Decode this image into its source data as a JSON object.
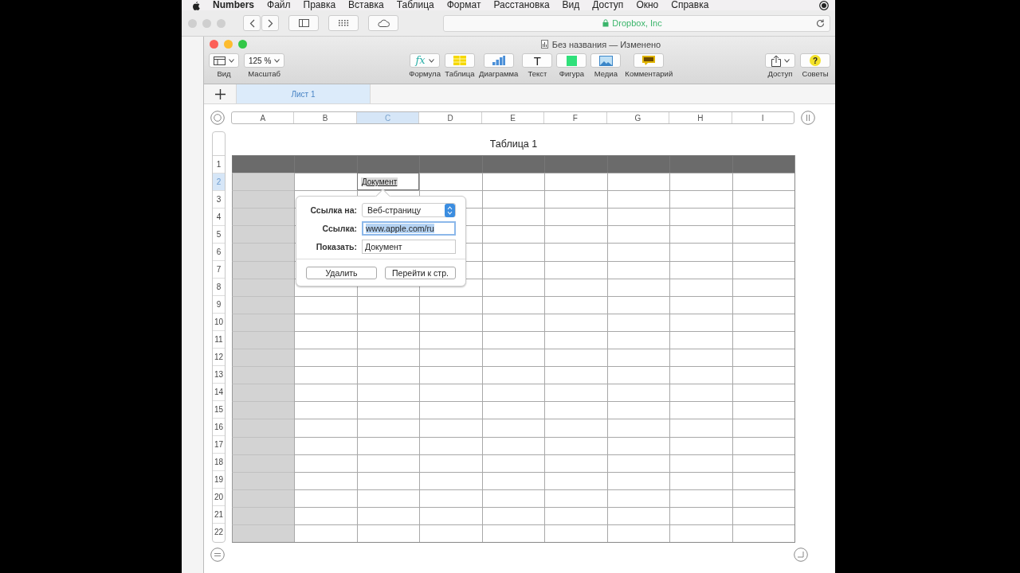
{
  "menubar": {
    "app": "Numbers",
    "items": [
      "Файл",
      "Правка",
      "Вставка",
      "Таблица",
      "Формат",
      "Расстановка",
      "Вид",
      "Доступ",
      "Окно",
      "Справка"
    ]
  },
  "browser_bar": {
    "address": "Dropbox, Inc"
  },
  "window": {
    "title": "Без названия — Изменено"
  },
  "toolbar": {
    "left": [
      {
        "kind": "view",
        "label": "Вид"
      },
      {
        "kind": "zoom",
        "label": "Масштаб",
        "value": "125 %"
      }
    ],
    "center": [
      {
        "kind": "formula",
        "label": "Формула",
        "glyph": "fx"
      },
      {
        "kind": "table",
        "label": "Таблица"
      },
      {
        "kind": "chart",
        "label": "Диаграмма"
      },
      {
        "kind": "text",
        "label": "Текст",
        "glyph": "T"
      },
      {
        "kind": "shape",
        "label": "Фигура"
      },
      {
        "kind": "media",
        "label": "Медиа"
      },
      {
        "kind": "comment",
        "label": "Комментарий"
      }
    ],
    "right": [
      {
        "kind": "share",
        "label": "Доступ"
      },
      {
        "kind": "tips",
        "label": "Советы",
        "glyph": "?"
      }
    ]
  },
  "sheet_tabs": [
    {
      "label": "Лист 1",
      "selected": true
    }
  ],
  "table": {
    "title": "Таблица 1",
    "columns": [
      {
        "label": "A",
        "selected": false
      },
      {
        "label": "B",
        "selected": false
      },
      {
        "label": "C",
        "selected": true
      },
      {
        "label": "D",
        "selected": false
      },
      {
        "label": "E",
        "selected": false
      },
      {
        "label": "F",
        "selected": false
      },
      {
        "label": "G",
        "selected": false
      },
      {
        "label": "H",
        "selected": false
      },
      {
        "label": "I",
        "selected": false
      }
    ],
    "rows": [
      {
        "label": "1",
        "selected": false
      },
      {
        "label": "2",
        "selected": true,
        "link_cell": {
          "text": "Документ"
        }
      },
      {
        "label": "3",
        "selected": false
      },
      {
        "label": "4",
        "selected": false
      },
      {
        "label": "5",
        "selected": false
      },
      {
        "label": "6",
        "selected": false
      },
      {
        "label": "7",
        "selected": false
      },
      {
        "label": "8",
        "selected": false
      },
      {
        "label": "9",
        "selected": false
      },
      {
        "label": "10",
        "selected": false
      },
      {
        "label": "11",
        "selected": false
      },
      {
        "label": "12",
        "selected": false
      },
      {
        "label": "13",
        "selected": false
      },
      {
        "label": "14",
        "selected": false
      },
      {
        "label": "15",
        "selected": false
      },
      {
        "label": "16",
        "selected": false
      },
      {
        "label": "17",
        "selected": false
      },
      {
        "label": "18",
        "selected": false
      },
      {
        "label": "19",
        "selected": false
      },
      {
        "label": "20",
        "selected": false
      },
      {
        "label": "21",
        "selected": false
      },
      {
        "label": "22",
        "selected": false
      }
    ]
  },
  "link_popover": {
    "fields": [
      {
        "kind": "select",
        "label": "Ссылка на:",
        "value": "Веб-страницу"
      },
      {
        "kind": "text",
        "label": "Ссылка:",
        "value": "www.apple.com/ru",
        "focused": true
      },
      {
        "kind": "text",
        "label": "Показать:",
        "value": "Документ",
        "focused": false
      }
    ],
    "buttons": [
      "Удалить",
      "Перейти к стр."
    ]
  }
}
